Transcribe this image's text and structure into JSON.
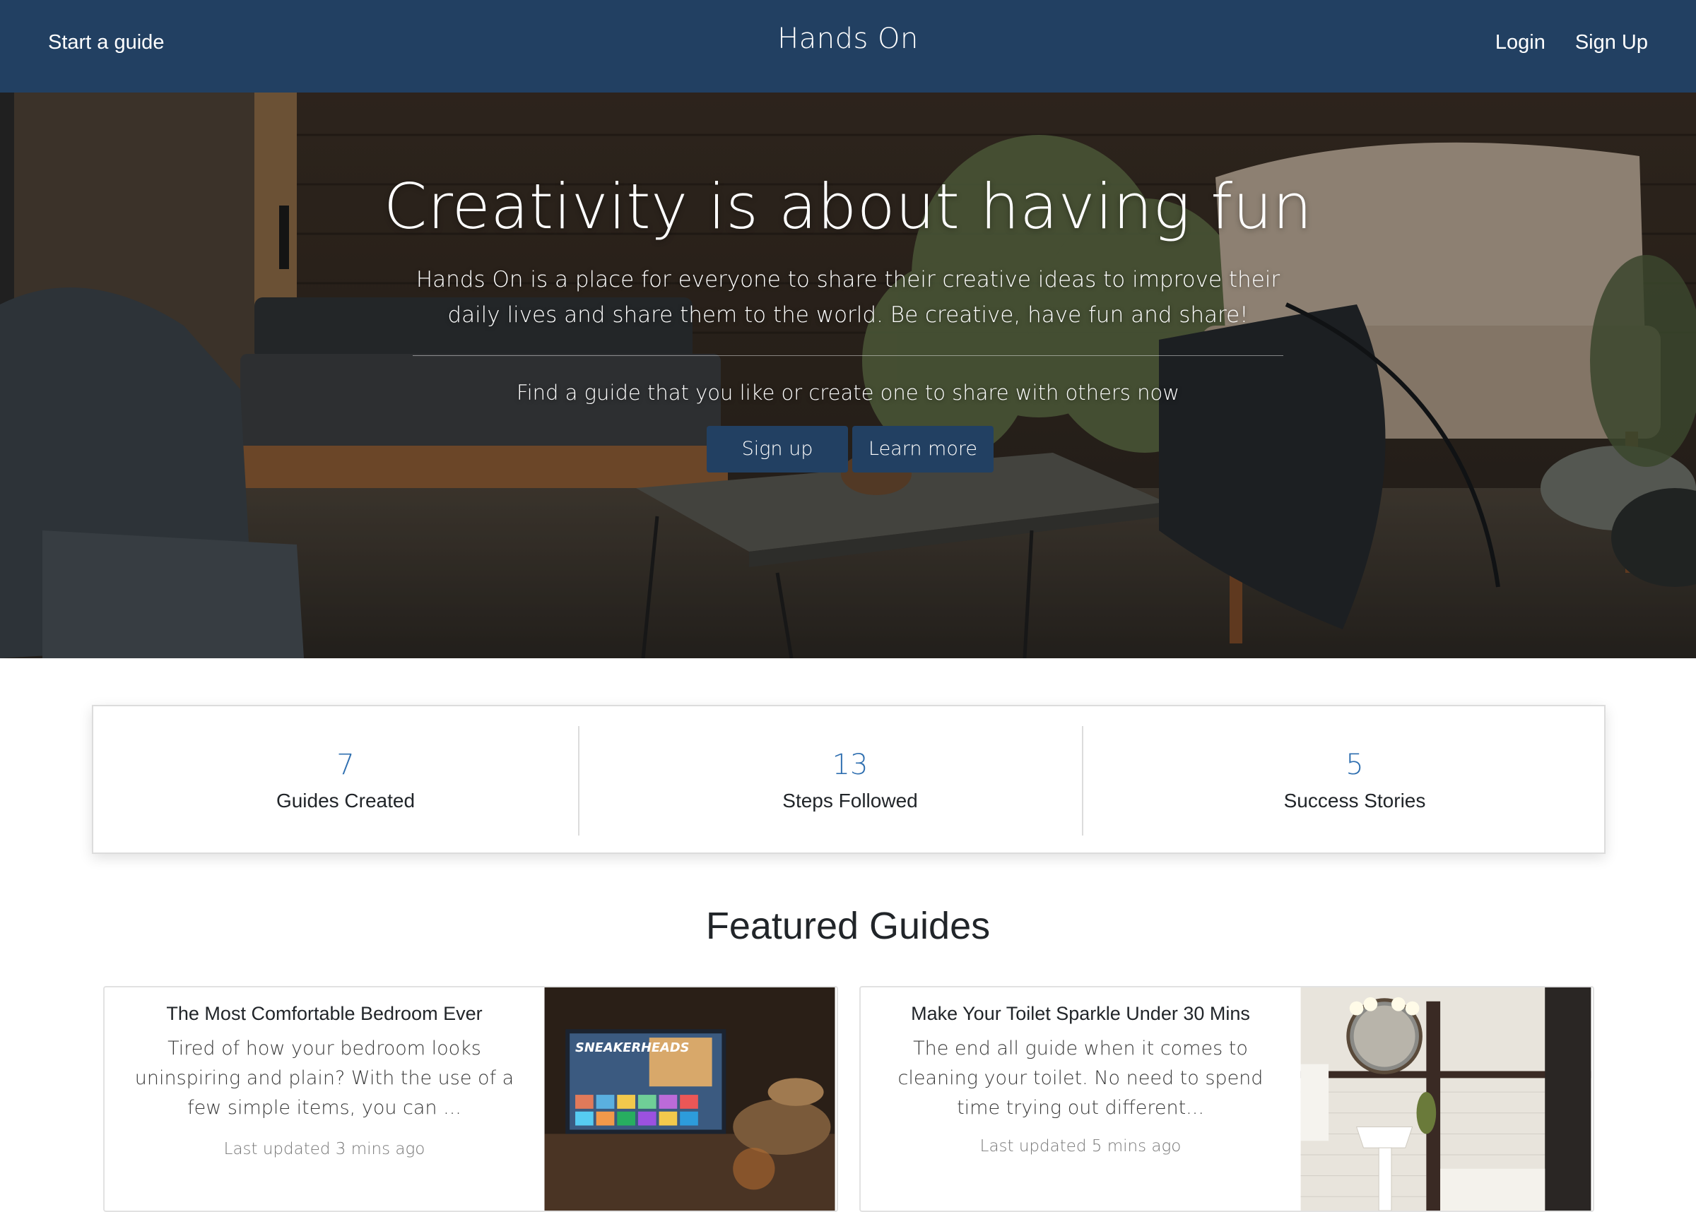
{
  "nav": {
    "start_guide": "Start a guide",
    "brand": "Hands On",
    "login": "Login",
    "signup": "Sign Up"
  },
  "hero": {
    "title": "Creativity is about having fun",
    "subtitle": "Hands On is a place for everyone to share their creative ideas to improve their daily lives and share them to the world. Be creative, have fun and share!",
    "cta_text": "Find a guide that you like or create one to share with others now",
    "signup_button": "Sign up",
    "learn_more_button": "Learn more"
  },
  "stats": [
    {
      "value": "7",
      "label": "Guides Created"
    },
    {
      "value": "13",
      "label": "Steps Followed"
    },
    {
      "value": "5",
      "label": "Success Stories"
    }
  ],
  "featured": {
    "heading": "Featured Guides",
    "cards": [
      {
        "title": "The Most Comfortable Bedroom Ever",
        "description": "Tired of how your bedroom looks uninspiring and plain? With the use of a few simple items, you can ...",
        "updated": "Last updated 3 mins ago",
        "image_icon": "bedroom-tv-image",
        "tv_text": "SNEAKERHEADS"
      },
      {
        "title": "Make Your Toilet Sparkle Under 30 Mins",
        "description": "The end all guide when it comes to cleaning your toilet. No need to spend time trying out different...",
        "updated": "Last updated 5 mins ago",
        "image_icon": "bathroom-image"
      }
    ]
  },
  "colors": {
    "navbar": "#224062",
    "button": "#224062",
    "stat_number": "#2f6fb0",
    "text": "#212529"
  }
}
